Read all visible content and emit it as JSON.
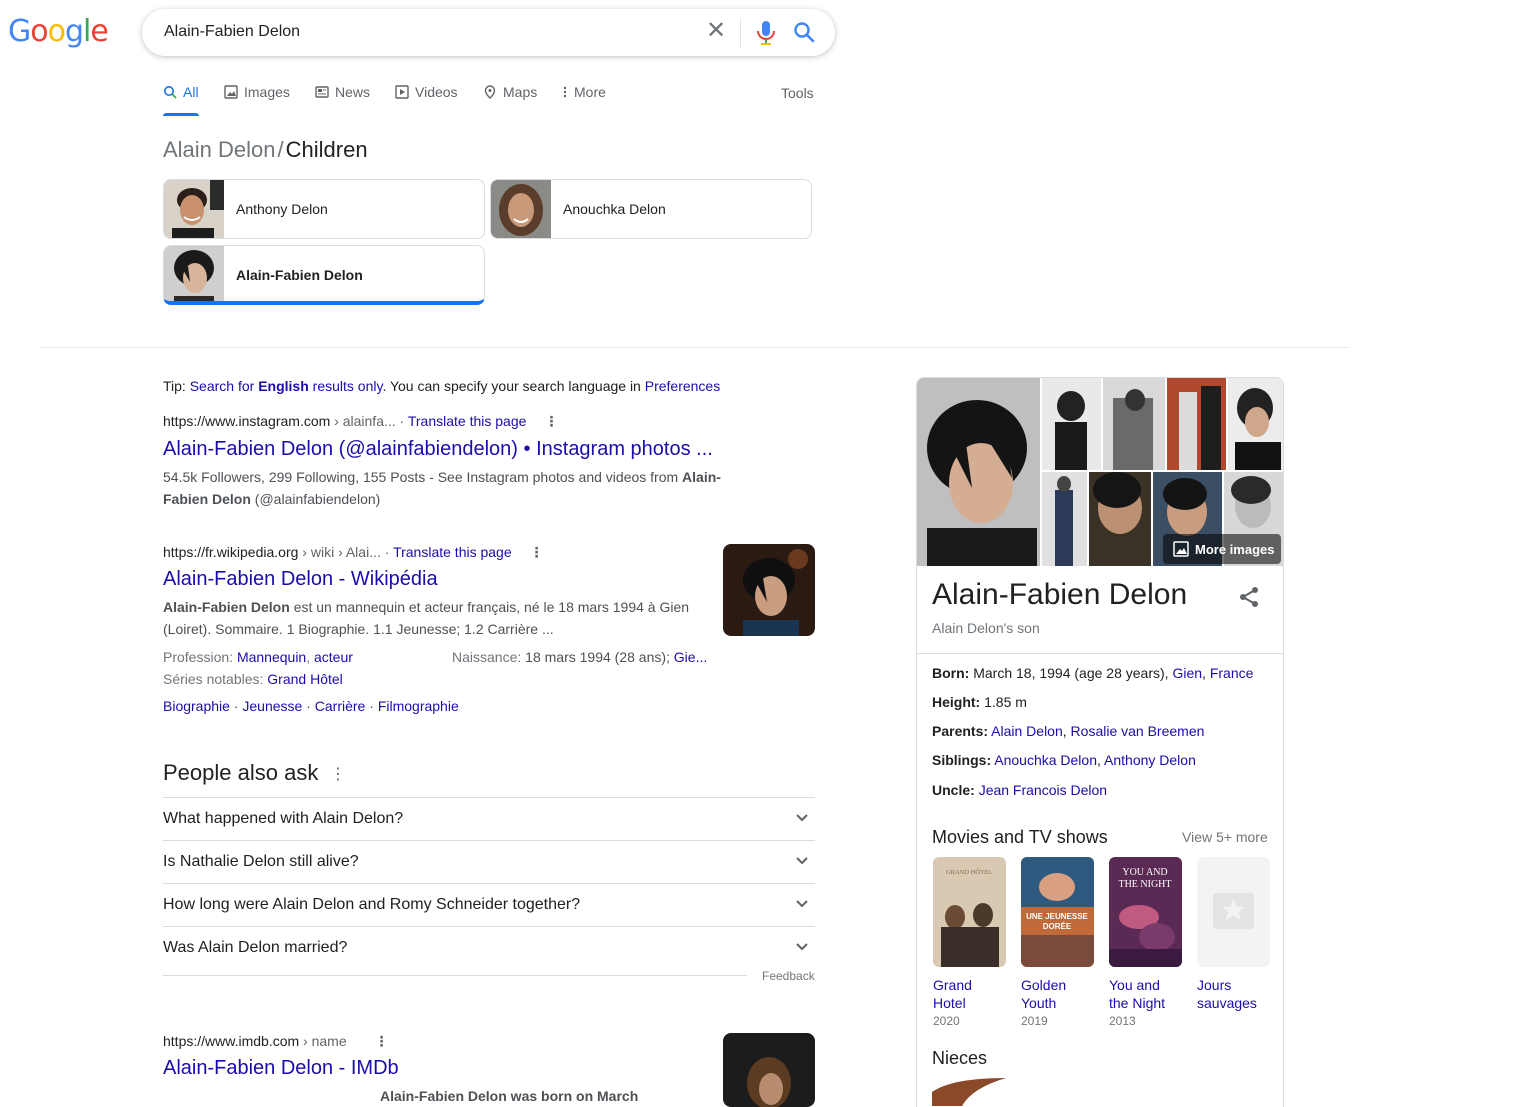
{
  "search": {
    "logo": "Google",
    "query": "Alain-Fabien Delon"
  },
  "tabs": [
    {
      "label": "All",
      "icon": "search-icon"
    },
    {
      "label": "Images",
      "icon": "image-icon"
    },
    {
      "label": "News",
      "icon": "news-icon"
    },
    {
      "label": "Videos",
      "icon": "video-icon"
    },
    {
      "label": "Maps",
      "icon": "map-pin-icon"
    },
    {
      "label": "More",
      "icon": "more-vert-icon"
    }
  ],
  "tools_label": "Tools",
  "breadcrumb": {
    "parent": "Alain Delon",
    "separator": "/",
    "current": "Children"
  },
  "children": [
    {
      "name": "Anthony Delon"
    },
    {
      "name": "Anouchka Delon"
    },
    {
      "name": "Alain-Fabien Delon",
      "selected": true
    }
  ],
  "tip": {
    "prefix": "Tip:",
    "link1": "Search for",
    "bold": "English",
    "link2": "results only",
    "middle": ". You can specify your search language in",
    "link3": "Preferences"
  },
  "results": [
    {
      "cite": "https://www.instagram.com",
      "path": " › alainfa...",
      "translate": "Translate this page",
      "title": "Alain-Fabien Delon (@alainfabiendelon) • Instagram photos ...",
      "snippet_line1": "54.5k Followers, 299 Following, 155 Posts - See Instagram photos and videos from",
      "snippet_bold1": "Alain-",
      "snippet_bold2": "Fabien Delon",
      "snippet_line2": "(@alainfabiendelon)"
    },
    {
      "cite": "https://fr.wikipedia.org",
      "path": " › wiki › Alai...",
      "translate": "Translate this page",
      "title": "Alain-Fabien Delon - Wikipédia",
      "snippet_bold": "Alain-Fabien Delon",
      "snippet_line1": "est un mannequin et acteur français, né le 18 mars 1994 à Gien",
      "snippet_line2": "(Loiret). Sommaire. 1 Biographie. 1.1 Jeunesse; 1.2 Carrière ...",
      "profession_label": "Profession:",
      "profession_1": "Mannequin",
      "profession_2": "acteur",
      "naissance_label": "Naissance:",
      "naissance_value": "18 mars 1994 (28 ans);",
      "naissance_link": "Gie...",
      "series_label": "Séries notables:",
      "series_value": "Grand Hôtel",
      "sitelinks": [
        "Biographie",
        "Jeunesse",
        "Carrière",
        "Filmographie"
      ]
    },
    {
      "cite": "https://www.imdb.com",
      "path": " › name",
      "title": "Alain-Fabien Delon - IMDb",
      "snippet_partial": "Alain-Fabien Delon was born on March"
    }
  ],
  "paa": {
    "heading": "People also ask",
    "questions": [
      "What happened with Alain Delon?",
      "Is Nathalie Delon still alive?",
      "How long were Alain Delon and Romy Schneider together?",
      "Was Alain Delon married?"
    ],
    "feedback": "Feedback"
  },
  "knowledge_panel": {
    "more_images": "More images",
    "name": "Alain-Fabien Delon",
    "subtitle": "Alain Delon's son",
    "born_label": "Born:",
    "born_value": "March 18, 1994 (age 28 years),",
    "born_link1": "Gien",
    "born_link2": "France",
    "height_label": "Height:",
    "height_value": "1.85 m",
    "parents_label": "Parents:",
    "parents_link1": "Alain Delon",
    "parents_link2": "Rosalie van Breemen",
    "siblings_label": "Siblings:",
    "siblings_link1": "Anouchka Delon",
    "siblings_link2": "Anthony Delon",
    "uncle_label": "Uncle:",
    "uncle_link": "Jean Francois Delon",
    "movies_heading": "Movies and TV shows",
    "view_more": "View 5+ more",
    "movies": [
      {
        "title_l1": "Grand",
        "title_l2": "Hotel",
        "year": "2020",
        "poster_text": "GRAND HÔTEL"
      },
      {
        "title_l1": "Golden",
        "title_l2": "Youth",
        "year": "2019",
        "poster_text": "UNE JEUNESSE DORÉE"
      },
      {
        "title_l1": "You and",
        "title_l2": "the Night",
        "year": "2013",
        "poster_text": "YOU AND THE NIGHT"
      },
      {
        "title_l1": "Jours",
        "title_l2": "sauvages",
        "year": ""
      }
    ],
    "nieces_heading": "Nieces"
  },
  "colors": {
    "link": "#1a0dab",
    "accent": "#1a73e8",
    "text": "#202124",
    "muted": "#70757a"
  }
}
